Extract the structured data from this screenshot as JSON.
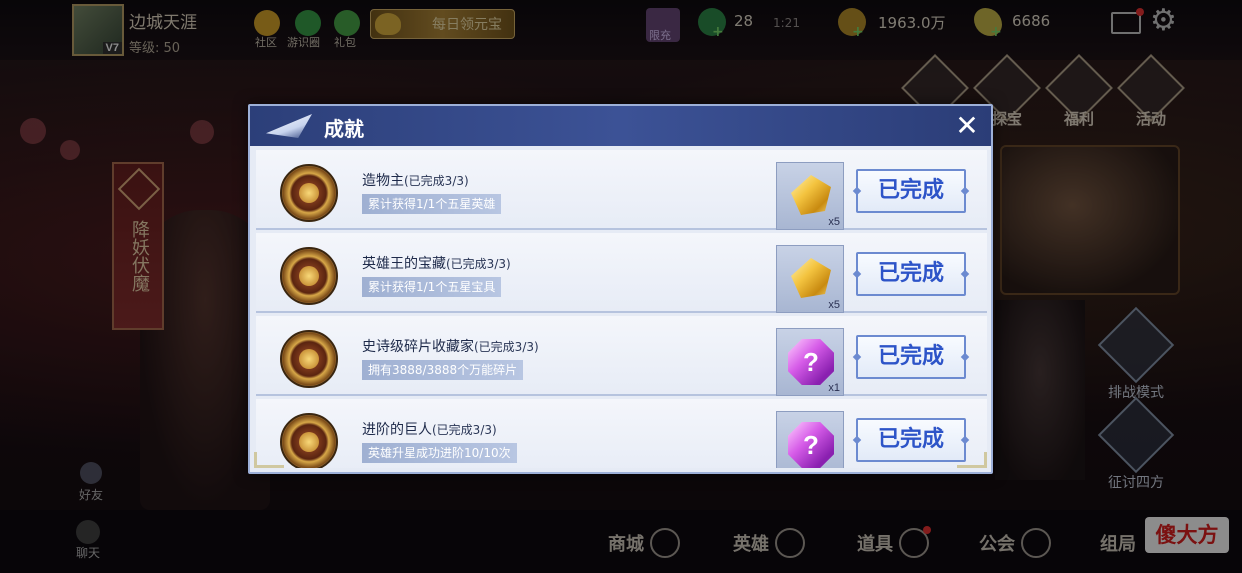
{
  "player": {
    "name": "边城天涯",
    "vip": "V7",
    "level": "等级: 50"
  },
  "top_links": [
    {
      "label": "社区",
      "icon": "community-icon"
    },
    {
      "label": "游识圈",
      "icon": "circle-icon"
    },
    {
      "label": "礼包",
      "icon": "gift-icon"
    }
  ],
  "daily_button": "每日领元宝",
  "limit_badge": "限充",
  "resources": {
    "energy": "28",
    "timer": "1:21",
    "coins": "1963.0万",
    "ingots": "6686"
  },
  "side_menu": [
    {
      "label": "探宝"
    },
    {
      "label": "福利"
    },
    {
      "label": "活动"
    }
  ],
  "event_banner": "降妖伏魔",
  "modes": [
    {
      "label": "排战模式"
    },
    {
      "label": "征讨四方"
    }
  ],
  "friend_label": "好友",
  "chat_label": "聊天",
  "bottom_nav": [
    {
      "label": "商城"
    },
    {
      "label": "英雄"
    },
    {
      "label": "道具"
    },
    {
      "label": "公会"
    },
    {
      "label": "组局"
    }
  ],
  "watermark": "傻大方",
  "dialog": {
    "title": "成就",
    "close_symbol": "✕",
    "achievements": [
      {
        "title": "造物主",
        "progress": "(已完成3/3)",
        "desc": "累计获得1/1个五星英雄",
        "reward_type": "gold-crystal",
        "reward_qty": "x5",
        "status": "已完成"
      },
      {
        "title": "英雄王的宝藏",
        "progress": "(已完成3/3)",
        "desc": "累计获得1/1个五星宝具",
        "reward_type": "gold-crystal",
        "reward_qty": "x5",
        "status": "已完成"
      },
      {
        "title": "史诗级碎片收藏家",
        "progress": "(已完成3/3)",
        "desc": "拥有3888/3888个万能碎片",
        "reward_type": "purple-mystery-crystal",
        "reward_qty": "x1",
        "status": "已完成"
      },
      {
        "title": "进阶的巨人",
        "progress": "(已完成3/3)",
        "desc": "英雄升星成功进阶10/10次",
        "reward_type": "purple-mystery-crystal",
        "reward_qty": "",
        "status": "已完成"
      }
    ]
  },
  "colors": {
    "dialog_header": "#3c5296",
    "done_text": "#2d54c8",
    "dialog_bg": "#e6ebf5"
  }
}
